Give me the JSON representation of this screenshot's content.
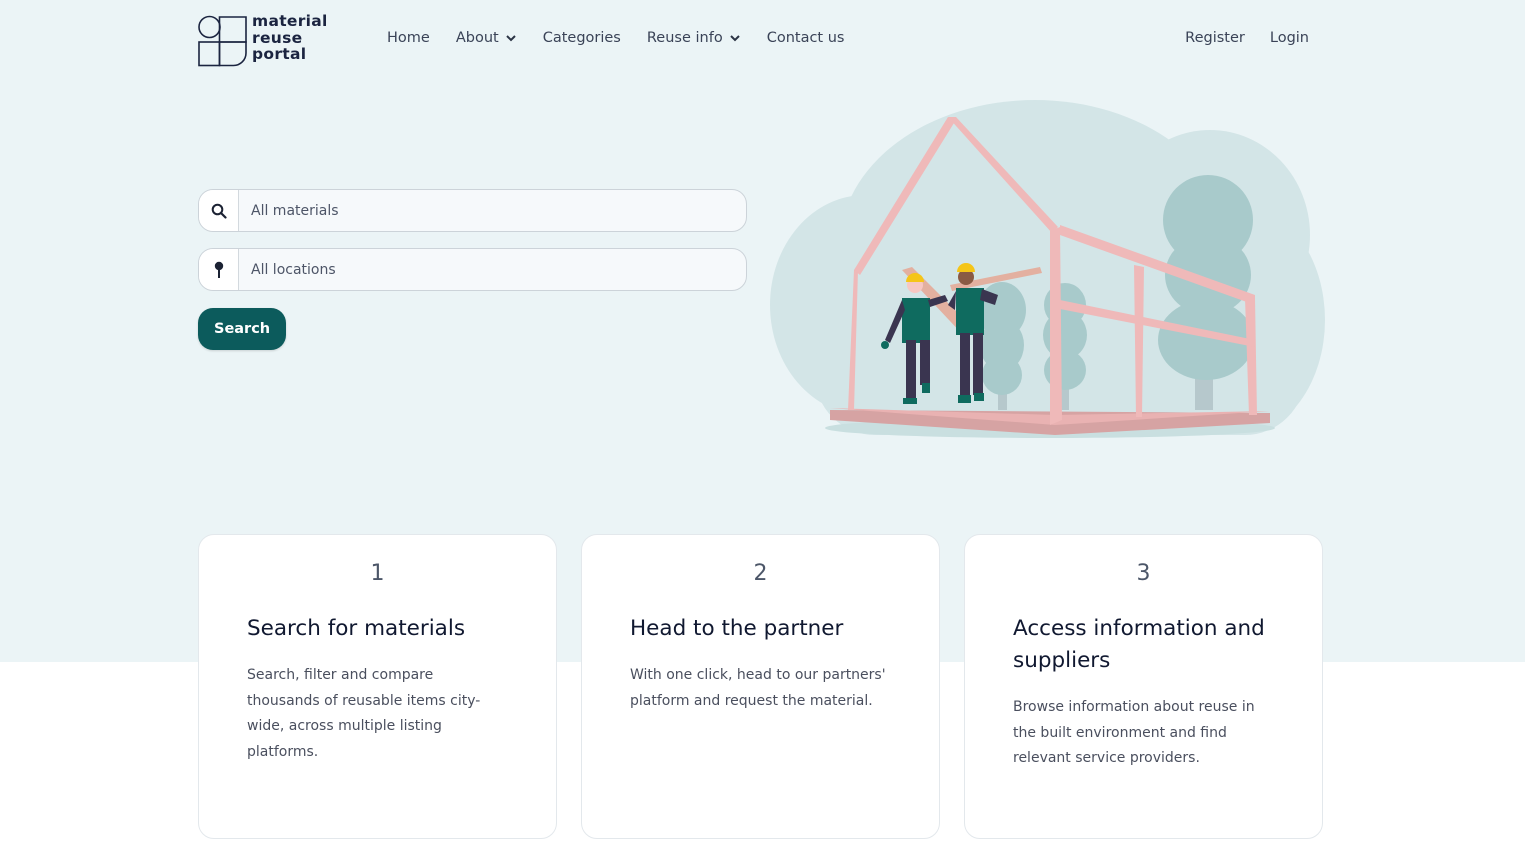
{
  "brand": {
    "logo_lines": [
      "material",
      "reuse",
      "portal"
    ]
  },
  "nav": {
    "items": [
      {
        "label": "Home",
        "has_dropdown": false
      },
      {
        "label": "About",
        "has_dropdown": true
      },
      {
        "label": "Categories",
        "has_dropdown": false
      },
      {
        "label": "Reuse info",
        "has_dropdown": true
      },
      {
        "label": "Contact us",
        "has_dropdown": false
      }
    ],
    "auth": {
      "register": "Register",
      "login": "Login"
    }
  },
  "search": {
    "materials_placeholder": "All materials",
    "locations_placeholder": "All locations",
    "materials_icon": "search-icon",
    "locations_icon": "map-pin-icon",
    "button_label": "Search"
  },
  "illustration": {
    "description": "Two construction workers carrying wooden planks inside a pink house frame with trees in background"
  },
  "steps": [
    {
      "number": "1",
      "title": "Search for materials",
      "text": "Search, filter and compare thousands of reusable items city-wide, across multiple listing platforms."
    },
    {
      "number": "2",
      "title": "Head to the partner",
      "text": "With one click, head to our partners' platform and request the material."
    },
    {
      "number": "3",
      "title": "Access information and suppliers",
      "text": "Browse information about reuse in the built environment and find relevant service providers."
    }
  ],
  "colors": {
    "hero_bg": "#ebf4f6",
    "primary_button": "#0c5b5c",
    "text_dark": "#101830",
    "frame_pink": "#efb9b9",
    "vest_green": "#0f6b5f",
    "helmet_yellow": "#f5c518"
  }
}
